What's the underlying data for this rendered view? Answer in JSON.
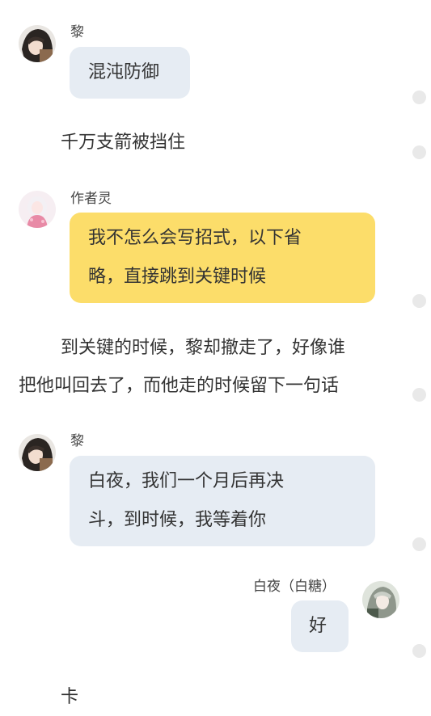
{
  "chat": {
    "m1": {
      "name": "黎",
      "text": "混沌防御"
    },
    "n1": "千万支箭被挡住",
    "m2": {
      "name": "作者灵",
      "line1": "我不怎么会写招式，以下省",
      "line2": "略，直接跳到关键时候"
    },
    "n2": {
      "line1": "到关键的时候，黎却撤走了，好像谁",
      "line2": "把他叫回去了，而他走的时候留下一句话"
    },
    "m3": {
      "name": "黎",
      "line1": "白夜，我们一个月后再决",
      "line2": "斗，到时候，我等着你"
    },
    "m4": {
      "name": "白夜（白糖）",
      "text": "好"
    },
    "n3": "卡"
  },
  "colors": {
    "blue_bubble": "#e6ecf3",
    "yellow_bubble": "#fcdd6a",
    "dot": "#e9e9e9"
  }
}
